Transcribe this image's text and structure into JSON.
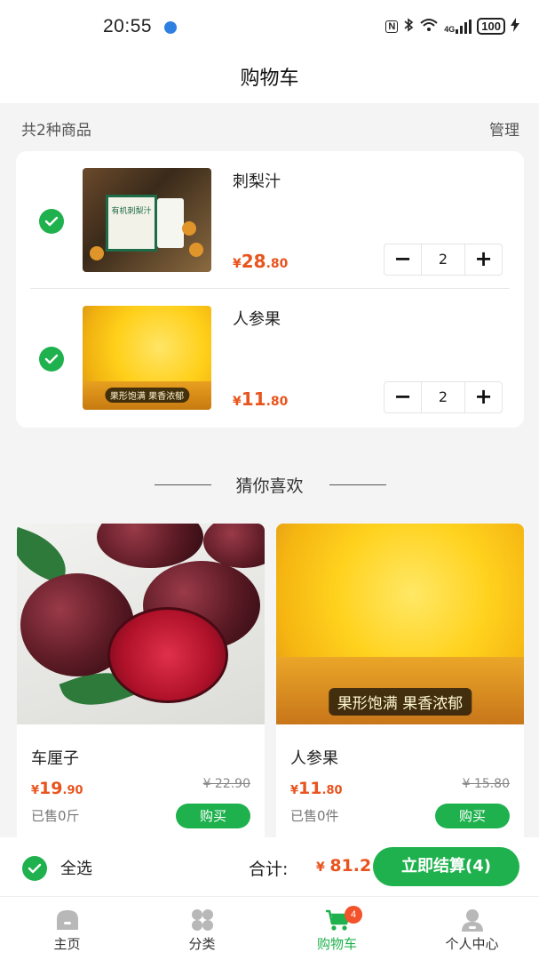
{
  "status_bar": {
    "time": "20:55",
    "nfc": "N",
    "network": "4G",
    "battery": "100"
  },
  "header": {
    "title": "购物车"
  },
  "summary": {
    "count_text": "共2种商品",
    "manage_label": "管理"
  },
  "cart_items": [
    {
      "name": "刺梨汁",
      "price_symbol": "¥",
      "price_int": "28",
      "price_dec": ".80",
      "quantity": "2",
      "minus": "−",
      "plus": "+",
      "image_text": "有机刺梨汁"
    },
    {
      "name": "人参果",
      "price_symbol": "¥",
      "price_int": "11",
      "price_dec": ".80",
      "quantity": "2",
      "minus": "−",
      "plus": "+",
      "image_text": "果形饱满 果香浓郁"
    }
  ],
  "guess_section": {
    "title": "猜你喜欢"
  },
  "recommendations": [
    {
      "name": "车厘子",
      "price_symbol": "¥",
      "price_int": "19",
      "price_dec": ".90",
      "original_price": "¥ 22.90",
      "sold": "已售0斤",
      "buy_label": "购买"
    },
    {
      "name": "人参果",
      "price_symbol": "¥",
      "price_int": "11",
      "price_dec": ".80",
      "original_price": "¥ 15.80",
      "sold": "已售0件",
      "buy_label": "购买",
      "image_text": "果形饱满 果香浓郁"
    }
  ],
  "checkout": {
    "select_all_label": "全选",
    "total_label": "合计:",
    "total_symbol": "¥",
    "total_value": "81.2",
    "checkout_label": "立即结算(4)"
  },
  "tabs": [
    {
      "label": "主页",
      "icon": "home-icon"
    },
    {
      "label": "分类",
      "icon": "category-icon"
    },
    {
      "label": "购物车",
      "icon": "cart-icon",
      "badge": "4",
      "active": true
    },
    {
      "label": "个人中心",
      "icon": "user-icon"
    }
  ],
  "colors": {
    "accent_green": "#1fb14d",
    "price_orange": "#e8541e",
    "badge_red": "#f2532a"
  }
}
